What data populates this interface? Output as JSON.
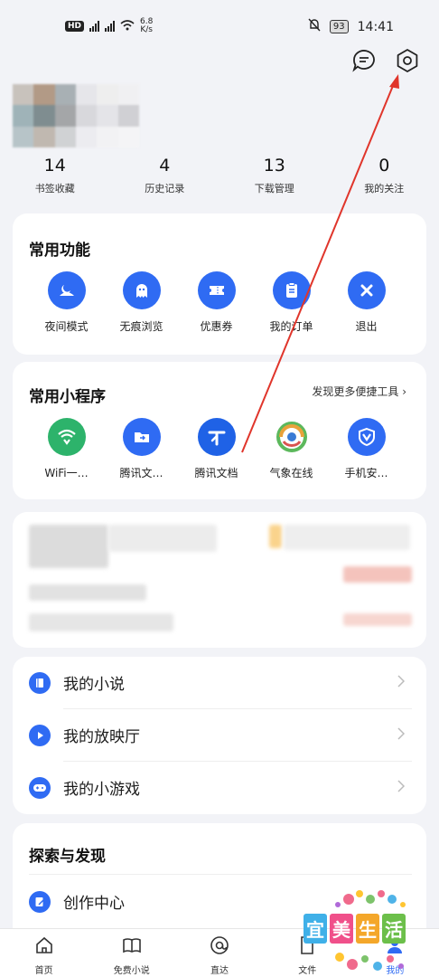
{
  "status_bar": {
    "hd": "HD",
    "net_speed": "6.8",
    "net_unit": "K/s",
    "battery": "93",
    "time": "14:41",
    "signal1": "5G",
    "signal2": "4G"
  },
  "header": {
    "message_icon": "message-icon",
    "settings_icon": "settings-icon"
  },
  "stats": [
    {
      "num": "14",
      "label": "书签收藏"
    },
    {
      "num": "4",
      "label": "历史记录"
    },
    {
      "num": "13",
      "label": "下载管理"
    },
    {
      "num": "0",
      "label": "我的关注"
    }
  ],
  "common_functions": {
    "title": "常用功能",
    "items": [
      {
        "label": "夜间模式",
        "icon": "moon-icon",
        "color": "#2f6bf3"
      },
      {
        "label": "无痕浏览",
        "icon": "ghost-icon",
        "color": "#2f6bf3"
      },
      {
        "label": "优惠券",
        "icon": "ticket-icon",
        "color": "#2f6bf3"
      },
      {
        "label": "我的订单",
        "icon": "clipboard-icon",
        "color": "#2f6bf3"
      },
      {
        "label": "退出",
        "icon": "close-icon",
        "color": "#2f6bf3"
      }
    ]
  },
  "mini_programs": {
    "title": "常用小程序",
    "more": "发现更多便捷工具",
    "items": [
      {
        "label": "WiFi一…",
        "icon": "wifi-shield-icon"
      },
      {
        "label": "腾讯文…",
        "icon": "folder-icon"
      },
      {
        "label": "腾讯文档",
        "icon": "tencent-docs-icon"
      },
      {
        "label": "气象在线",
        "icon": "weather-icon"
      },
      {
        "label": "手机安…",
        "icon": "shield-check-icon"
      }
    ]
  },
  "my_list": [
    {
      "label": "我的小说",
      "icon": "book-icon"
    },
    {
      "label": "我的放映厅",
      "icon": "play-icon"
    },
    {
      "label": "我的小游戏",
      "icon": "gamepad-icon"
    }
  ],
  "explore": {
    "title": "探索与发现",
    "items": [
      {
        "label": "创作中心",
        "icon": "edit-icon"
      }
    ]
  },
  "tabbar": [
    {
      "label": "首页",
      "icon": "home-icon"
    },
    {
      "label": "免费小说",
      "icon": "open-book-icon"
    },
    {
      "label": "直达",
      "icon": "direct-icon"
    },
    {
      "label": "文件",
      "icon": "file-icon"
    },
    {
      "label": "我的",
      "icon": "user-icon"
    }
  ],
  "watermark": {
    "chars": [
      "宜",
      "美",
      "生",
      "活"
    ]
  },
  "colors": {
    "accent": "#2f6bf3",
    "annotation_arrow": "#e0352b"
  }
}
